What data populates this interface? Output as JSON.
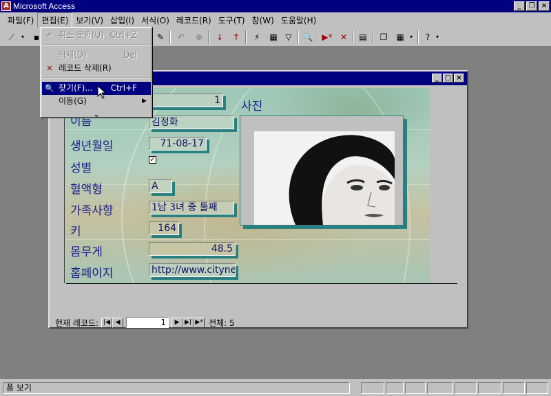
{
  "app": {
    "title": "Microsoft Access",
    "icon_text": "A"
  },
  "menubar": [
    {
      "label": "파일(F)",
      "name": "menu-file"
    },
    {
      "label": "편집(E)",
      "name": "menu-edit"
    },
    {
      "label": "보기(V)",
      "name": "menu-view"
    },
    {
      "label": "삽입(I)",
      "name": "menu-insert"
    },
    {
      "label": "서식(O)",
      "name": "menu-format"
    },
    {
      "label": "레코드(R)",
      "name": "menu-records"
    },
    {
      "label": "도구(T)",
      "name": "menu-tools"
    },
    {
      "label": "창(W)",
      "name": "menu-window"
    },
    {
      "label": "도움말(H)",
      "name": "menu-help"
    }
  ],
  "edit_menu": {
    "undo": {
      "label": "취소 못함(U)",
      "shortcut": "Ctrl+Z"
    },
    "delete": {
      "label": "삭제(D)",
      "shortcut": "Del"
    },
    "delete_record": {
      "label": "레코드 삭제(R)"
    },
    "find": {
      "label": "찾기(F)...",
      "shortcut": "Ctrl+F"
    },
    "goto": {
      "label": "이동(G)"
    },
    "expand": "⌄"
  },
  "form": {
    "fields": {
      "id": {
        "value": "1"
      },
      "name": {
        "label": "이름",
        "value": "김정화"
      },
      "birth": {
        "label": "생년월일",
        "value": "71-08-17"
      },
      "gender": {
        "label": "성별",
        "checked": true,
        "check_glyph": "✓"
      },
      "blood": {
        "label": "혈액형",
        "value": "A"
      },
      "family": {
        "label": "가족사항",
        "value": "1남 3녀 중 둘째"
      },
      "height": {
        "label": "키",
        "value": "164"
      },
      "weight": {
        "label": "몸무게",
        "value": "48.5"
      },
      "homepage": {
        "label": "홈페이지",
        "value": "http://www.cityne"
      }
    },
    "photo_label": "사진"
  },
  "record_nav": {
    "label": "현재 레코드:",
    "current": "1",
    "total_label": "전체: 5"
  },
  "status": {
    "text": "폼 보기"
  },
  "colors": {
    "titlebar": "#000080",
    "face": "#c0c0c0",
    "desktop": "#808080",
    "field_text": "#101060",
    "label_text": "#1a1a8a",
    "shadow": "#2a8080"
  }
}
